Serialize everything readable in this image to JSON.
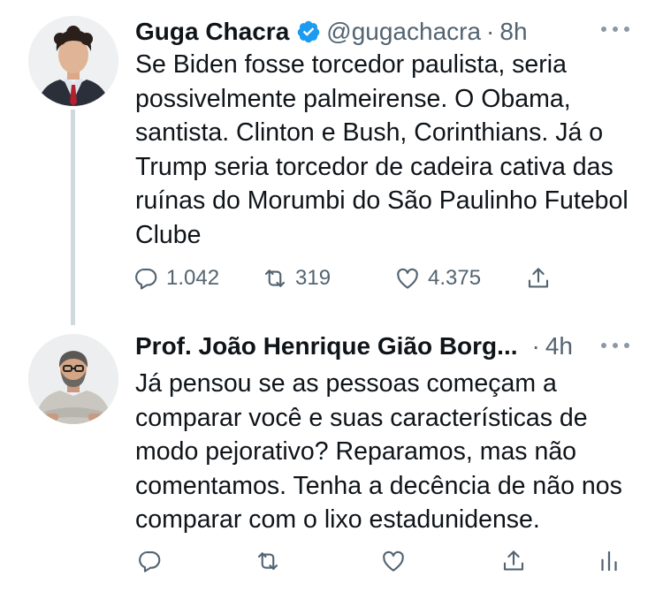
{
  "tweets": [
    {
      "author_name": "Guga Chacra",
      "handle": "@gugachacra",
      "separator": "·",
      "time": "8h",
      "text": "Se Biden fosse torcedor paulista, seria possivelmente palmeirense. O Obama, santista. Clinton e Bush, Corinthians. Já o Trump seria torcedor de cadeira cativa das ruínas do Morumbi do São Paulinho Futebol Clube",
      "reply_count": "1.042",
      "retweet_count": "319",
      "like_count": "4.375"
    },
    {
      "author_name": "Prof. João Henrique Gião Borg...",
      "separator": "·",
      "time": "4h",
      "text": "Já pensou se as pessoas começam a comparar você e suas características de modo pejorativo? Reparamos, mas não comentamos. Tenha a decência de não nos comparar com o lixo estadunidense."
    }
  ],
  "icons": {
    "verified": "verified-badge-icon",
    "more": "more-horizontal-icon",
    "reply": "reply-icon",
    "retweet": "retweet-icon",
    "like": "heart-icon",
    "share": "share-icon",
    "analytics": "analytics-icon"
  },
  "colors": {
    "verified_blue": "#1d9bf0",
    "text_primary": "#0f1419",
    "text_secondary": "#536471",
    "thread_line": "#cfd9de"
  }
}
